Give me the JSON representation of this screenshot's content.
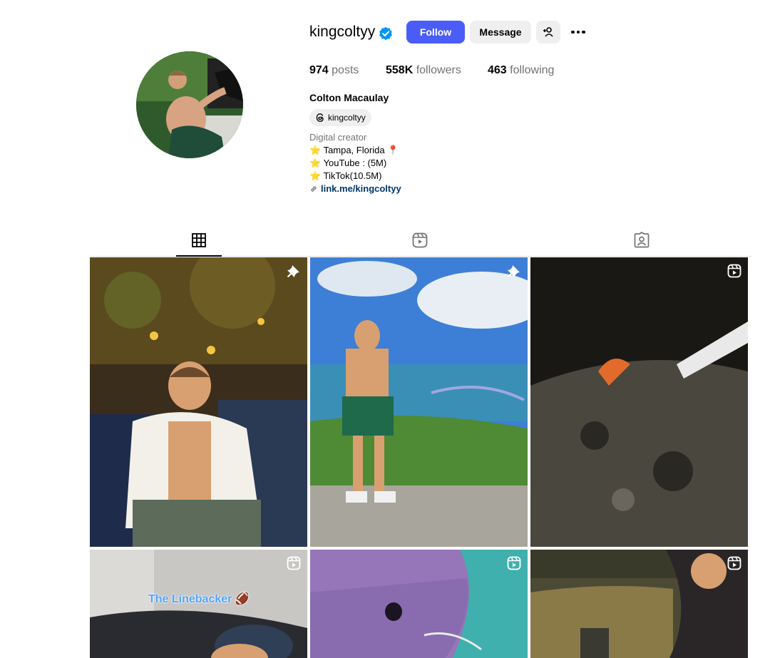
{
  "profile": {
    "username": "kingcoltyy",
    "verified": true,
    "follow_label": "Follow",
    "message_label": "Message",
    "add_user_icon": "add-person-icon",
    "more_icon": "ellipsis-icon",
    "full_name": "Colton Macaulay",
    "threads_handle": "kingcoltyy",
    "category": "Digital creator",
    "bio_lines": [
      "⭐ Tampa, Florida 📍",
      "⭐ YouTube : (5M)",
      "⭐ TikTok(10.5M)"
    ],
    "link": "link.me/kingcoltyy"
  },
  "stats": {
    "posts_count": "974",
    "posts_label": "posts",
    "followers_count": "558K",
    "followers_label": "followers",
    "following_count": "463",
    "following_label": "following"
  },
  "tabs": [
    {
      "icon": "grid-icon",
      "active": true
    },
    {
      "icon": "reels-icon",
      "active": false
    },
    {
      "icon": "tagged-icon",
      "active": false
    }
  ],
  "posts": [
    {
      "badge": "pin-icon"
    },
    {
      "badge": "pin-icon"
    },
    {
      "badge": "reel-icon"
    },
    {
      "badge": "reel-icon",
      "overlay_text": "The Linebacker 🏈"
    },
    {
      "badge": "reel-icon"
    },
    {
      "badge": "reel-icon"
    }
  ],
  "colors": {
    "follow_button": "#4a5df9",
    "verified": "#0095f6",
    "link": "#00376b",
    "muted_text": "#737373",
    "secondary_button": "#efefef"
  }
}
